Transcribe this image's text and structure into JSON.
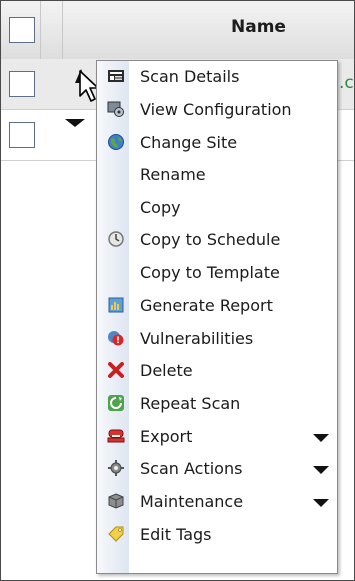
{
  "table": {
    "header_name": "Name",
    "row1_visible_fragment": ".c"
  },
  "menu": {
    "items": [
      {
        "label": "Scan Details",
        "icon": "scan-details-icon",
        "submenu": false
      },
      {
        "label": "View Configuration",
        "icon": "view-configuration-icon",
        "submenu": false
      },
      {
        "label": "Change Site",
        "icon": "change-site-icon",
        "submenu": false
      },
      {
        "label": "Rename",
        "icon": null,
        "submenu": false
      },
      {
        "label": "Copy",
        "icon": null,
        "submenu": false
      },
      {
        "label": "Copy to Schedule",
        "icon": "copy-to-schedule-icon",
        "submenu": false
      },
      {
        "label": "Copy to Template",
        "icon": null,
        "submenu": false
      },
      {
        "label": "Generate Report",
        "icon": "generate-report-icon",
        "submenu": false
      },
      {
        "label": "Vulnerabilities",
        "icon": "vulnerabilities-icon",
        "submenu": false
      },
      {
        "label": "Delete",
        "icon": "delete-icon",
        "submenu": false
      },
      {
        "label": "Repeat Scan",
        "icon": "repeat-scan-icon",
        "submenu": false
      },
      {
        "label": "Export",
        "icon": "export-icon",
        "submenu": true
      },
      {
        "label": "Scan Actions",
        "icon": "scan-actions-icon",
        "submenu": true
      },
      {
        "label": "Maintenance",
        "icon": "maintenance-icon",
        "submenu": true
      },
      {
        "label": "Edit Tags",
        "icon": "edit-tags-icon",
        "submenu": false
      }
    ]
  },
  "colors": {
    "row_link_green": "#2d8a3a",
    "menu_border": "#8a8a8a",
    "gutter": "#dfe6f2"
  }
}
